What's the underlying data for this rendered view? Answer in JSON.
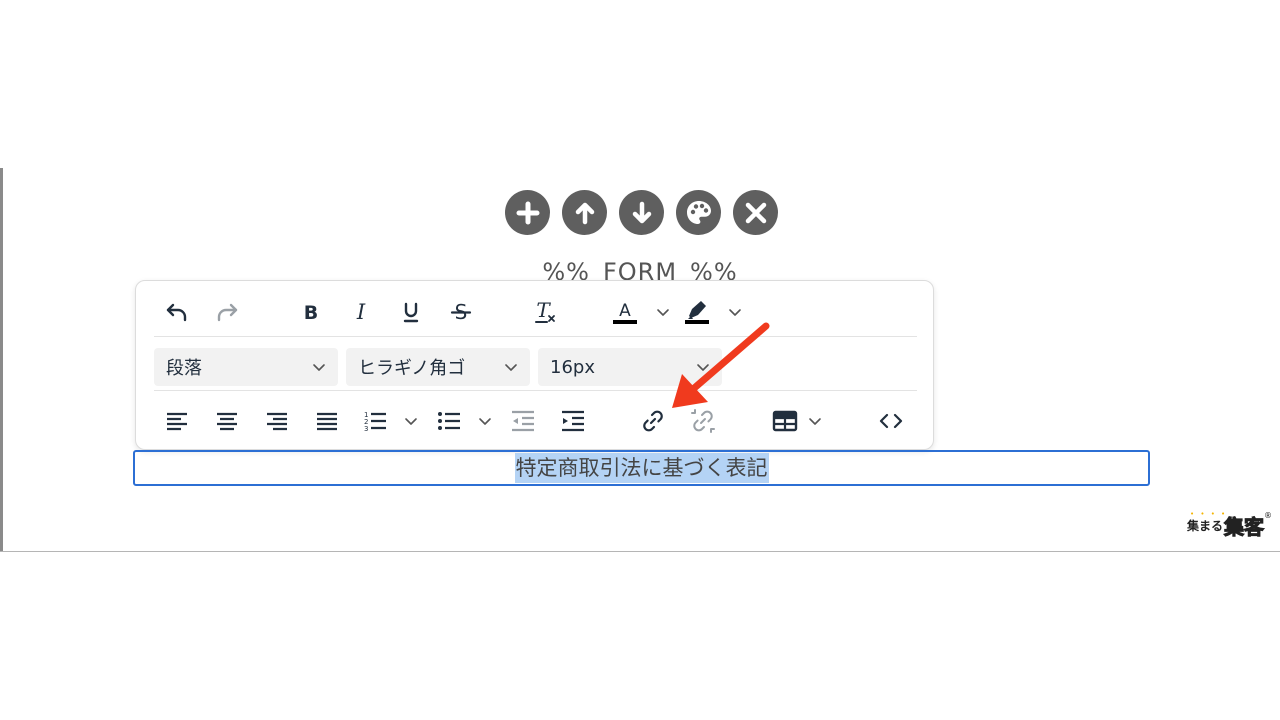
{
  "block_controls": [
    {
      "name": "add-block-button",
      "icon": "plus-icon"
    },
    {
      "name": "move-up-button",
      "icon": "arrow-up-icon"
    },
    {
      "name": "move-down-button",
      "icon": "arrow-down-icon"
    },
    {
      "name": "style-button",
      "icon": "palette-icon"
    },
    {
      "name": "delete-block-button",
      "icon": "close-icon"
    }
  ],
  "form_placeholder": "%%_FORM_%%",
  "toolbar": {
    "block_format": "段落",
    "font_family": "ヒラギノ角ゴ",
    "font_size": "16px",
    "text_color": "#000000",
    "highlight_color": "#000000",
    "icon_color": "#222f3e",
    "disabled_icon_color": "#9aa0a6"
  },
  "editor": {
    "selected_text": "特定商取引法に基づく表記"
  },
  "annotation": {
    "arrow_color": "#f03a1e"
  },
  "brand": {
    "small_text": "集まる",
    "big_text": "集客",
    "mark": "®",
    "dots": "• • • •"
  }
}
